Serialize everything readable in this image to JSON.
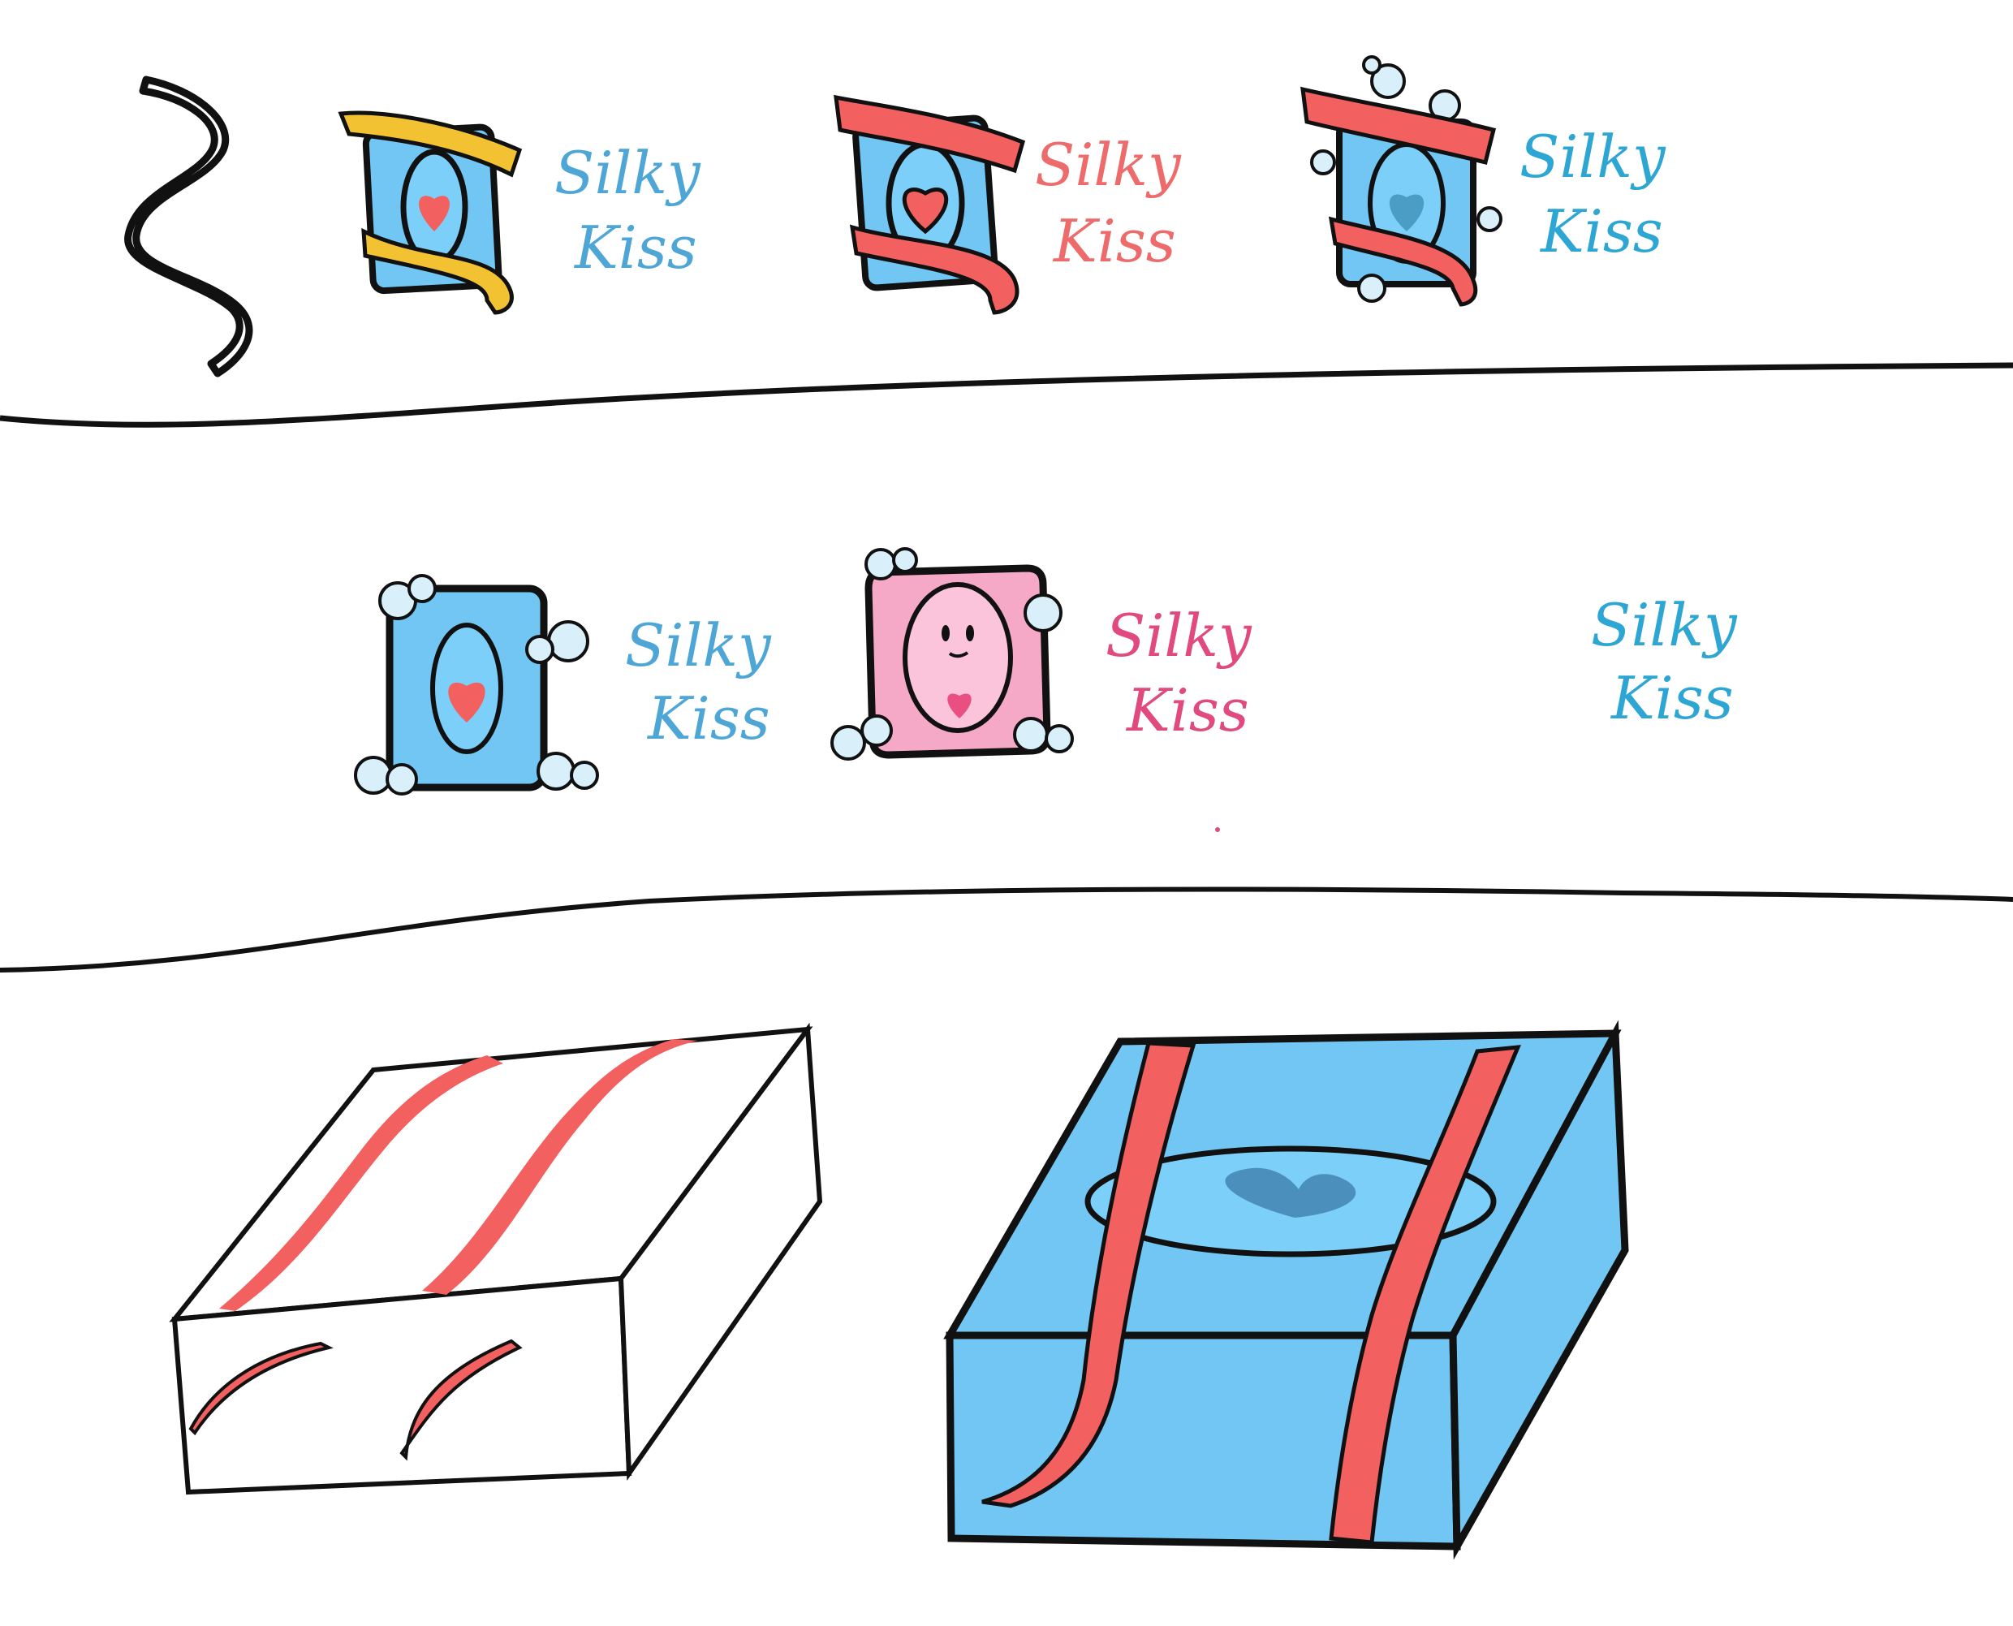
{
  "sheet": {
    "row1": {
      "logo_a": {
        "line1": "Silky",
        "line2": "Kiss",
        "text_color": "#4ea6d6",
        "ribbon_color": "#f2c232"
      },
      "logo_b": {
        "line1": "Silky",
        "line2": "Kiss",
        "text_color": "#ee6b6b",
        "ribbon_color": "#f2605f"
      },
      "logo_c": {
        "line1": "Silky",
        "line2": "Kiss",
        "text_color": "#2ea6d3",
        "ribbon_color": "#f2605f"
      }
    },
    "row2": {
      "logo_d": {
        "line1": "Silky",
        "line2": "Kiss",
        "text_color": "#4ea6d6"
      },
      "logo_e": {
        "line1": "Silky",
        "line2": "Kiss",
        "text_color": "#e04a7e"
      },
      "logo_f": {
        "line1": "Silky",
        "line2": "Kiss",
        "text_color": "#2ea6d3"
      }
    },
    "colors": {
      "soap_blue": "#72c6f4",
      "soap_pink": "#f6a9c6",
      "ribbon_red": "#f2605f",
      "ink": "#111111"
    }
  }
}
